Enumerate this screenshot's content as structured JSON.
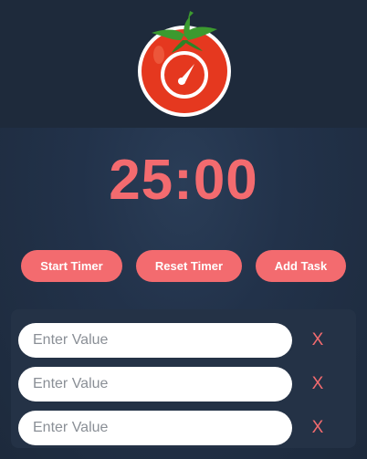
{
  "colors": {
    "accent": "#f36b6f",
    "background": "#1f2b3c",
    "panel": "#243246",
    "tomato": "#e5381f",
    "leaf": "#3c9a2f"
  },
  "logo": {
    "icon": "tomato-timer-icon"
  },
  "timer": {
    "display": "25:00"
  },
  "controls": {
    "start_label": "Start Timer",
    "reset_label": "Reset Timer",
    "add_label": "Add Task"
  },
  "tasks": [
    {
      "value": "",
      "placeholder": "Enter Value",
      "delete_label": "X"
    },
    {
      "value": "",
      "placeholder": "Enter Value",
      "delete_label": "X"
    },
    {
      "value": "",
      "placeholder": "Enter Value",
      "delete_label": "X"
    }
  ]
}
